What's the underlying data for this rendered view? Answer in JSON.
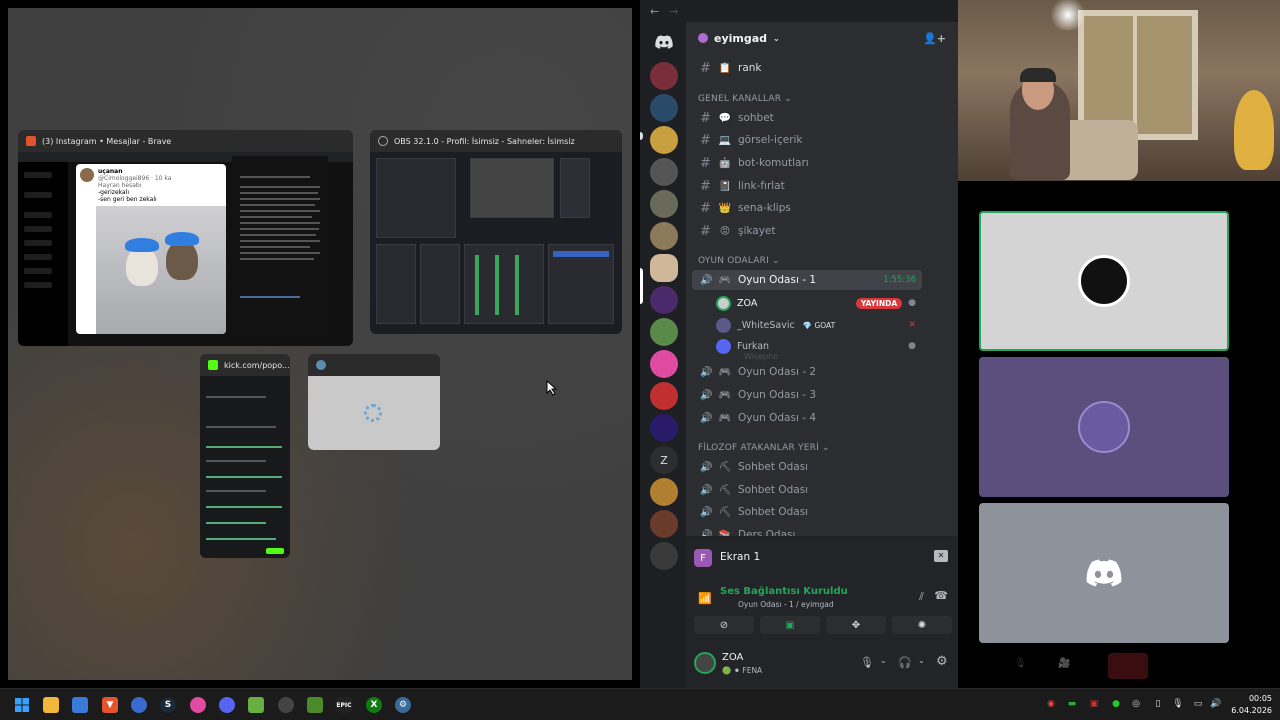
{
  "task_view": {
    "windows": [
      {
        "id": "instagram",
        "title": "(3) Instagram • Mesajlar - Brave"
      },
      {
        "id": "obs",
        "title": "OBS 32.1.0 - Profil: İsimsiz - Sahneler: İsimsiz"
      },
      {
        "id": "kick",
        "title": "kick.com/popo..."
      },
      {
        "id": "blank",
        "title": ""
      }
    ],
    "instagram_post": {
      "user": "uçanan",
      "handle": "@Cimologgei896 · 10 ka",
      "line1": "Hayran hesabı",
      "line2": "-gerizekalı",
      "line3": "-sen geri ben zekalı"
    }
  },
  "discord": {
    "server_name": "eyimgad",
    "top_channel": {
      "name": "rank",
      "emoji": "📋"
    },
    "categories": {
      "general": "GENEL KANALLAR",
      "games": "OYUN ODALARI",
      "philosopher": "FİLOZOF ATAKANLAR YERİ"
    },
    "text_channels": [
      {
        "emoji": "💬",
        "name": "sohbet"
      },
      {
        "emoji": "💻",
        "name": "görsel-içerik"
      },
      {
        "emoji": "🤖",
        "name": "bot-komutları"
      },
      {
        "emoji": "📓",
        "name": "link-fırlat"
      },
      {
        "emoji": "👑",
        "name": "sena-klips"
      },
      {
        "emoji": "😡",
        "name": "şikayet"
      }
    ],
    "voice_game": [
      {
        "name": "Oyun Odası - 1",
        "time": "1:55:36",
        "selected": true
      },
      {
        "name": "Oyun Odası - 2"
      },
      {
        "name": "Oyun Odası - 3"
      },
      {
        "name": "Oyun Odası - 4"
      }
    ],
    "voice_users": [
      {
        "name": "ZOA",
        "badge": "YAYINDA"
      },
      {
        "name": "_WhiteSavic",
        "badge": "GOAT"
      },
      {
        "name": "Furkan"
      }
    ],
    "ghost_user": "Wisepho",
    "voice_philosopher": [
      {
        "name": "Sohbet Odası"
      },
      {
        "name": "Sohbet Odası"
      },
      {
        "name": "Sohbet Odası"
      },
      {
        "name": "Ders Odası"
      }
    ],
    "screen_panel": {
      "initial": "F",
      "label": "Ekran 1"
    },
    "voice_status": {
      "title": "Ses Bağlantısı Kuruldu",
      "subtitle": "Oyun Odası - 1 / eyimgad"
    },
    "user_panel": {
      "name": "ZOA",
      "status": "FENA"
    },
    "server_letter": "Z"
  },
  "taskbar": {
    "time": "00:05",
    "date": "6.04.2026",
    "apps": [
      "windows-start",
      "file-explorer",
      "app-blue",
      "brave",
      "app-sphere",
      "steam",
      "app-pink",
      "discord",
      "app-green",
      "app-clock",
      "minecraft",
      "epic-games",
      "xbox",
      "app-gear"
    ]
  },
  "colors": {
    "discord_bg": "#2b2d31",
    "discord_dark": "#1e1f22",
    "live_red": "#da373c",
    "connected_green": "#23a55a",
    "blurple": "#5865f2"
  }
}
